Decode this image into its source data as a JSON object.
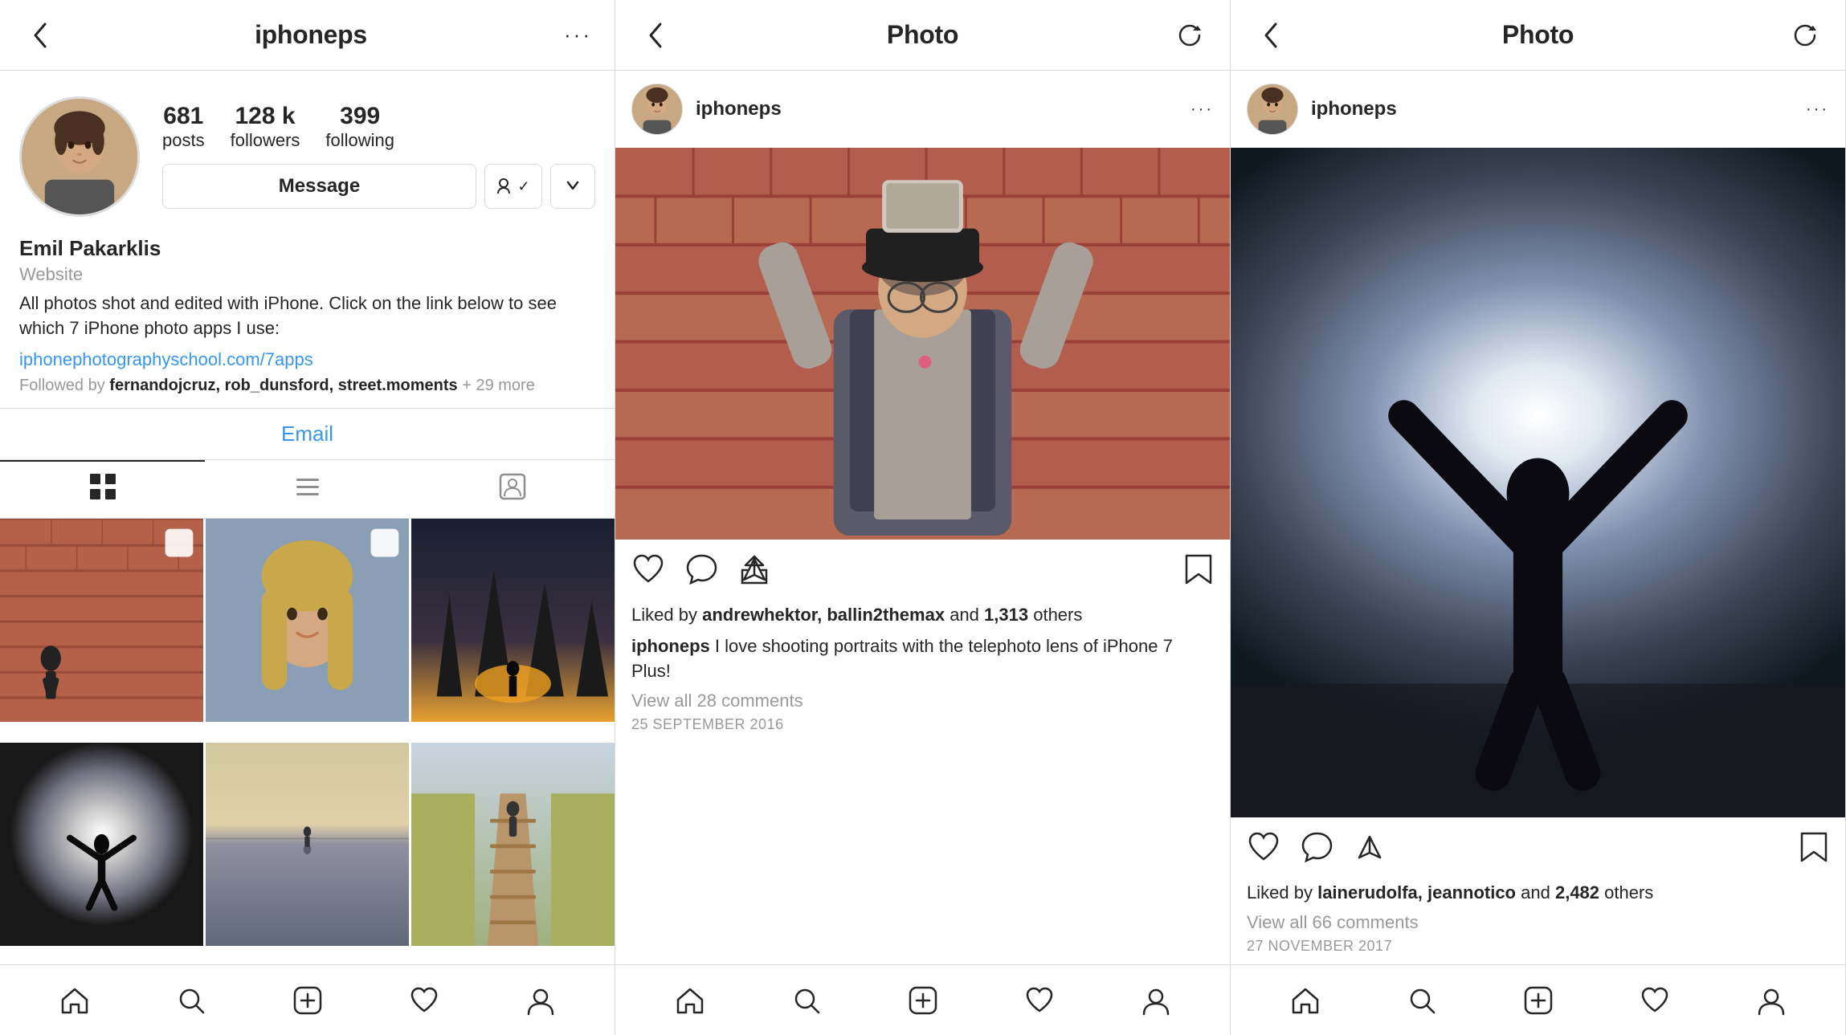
{
  "panels": [
    {
      "id": "profile",
      "nav": {
        "back_icon": "‹",
        "title": "iphoneps",
        "more_icon": "···"
      },
      "profile": {
        "username": "iphoneps",
        "name": "Emil Pakarklis",
        "website_label": "Website",
        "bio": "All photos shot and edited with iPhone. Click on the link below to see which 7 iPhone photo apps I use:",
        "link": "iphonephotographyschool.com/7apps",
        "followed_by": "Followed by",
        "followers_list": "fernandojcruz, rob_dunsford, street.moments",
        "more_count": "+ 29 more",
        "stats": [
          {
            "value": "681",
            "label": "posts"
          },
          {
            "value": "128 k",
            "label": "followers"
          },
          {
            "value": "399",
            "label": "following"
          }
        ],
        "message_btn": "Message",
        "email_label": "Email"
      },
      "tabs": [
        {
          "icon": "⊞",
          "active": true
        },
        {
          "icon": "≡",
          "active": false
        },
        {
          "icon": "👤",
          "active": false
        }
      ],
      "grid_photos": [
        {
          "color": "brick"
        },
        {
          "color": "portrait"
        },
        {
          "color": "forest"
        },
        {
          "color": "silhouette"
        },
        {
          "color": "lake"
        },
        {
          "color": "path"
        }
      ]
    },
    {
      "id": "photo1",
      "nav": {
        "back_icon": "‹",
        "title": "Photo",
        "refresh_icon": "↻"
      },
      "post": {
        "username": "iphoneps",
        "likes_text": "Liked by",
        "likers": "andrewhektor, ballin2themax",
        "and_text": "and",
        "likes_count": "1,313",
        "others": "others",
        "caption_user": "iphoneps",
        "caption_text": "I love shooting portraits with the telephoto lens of iPhone 7 Plus!",
        "view_comments": "View all 28 comments",
        "timestamp": "25 September 2016"
      }
    },
    {
      "id": "photo2",
      "nav": {
        "back_icon": "‹",
        "title": "Photo",
        "refresh_icon": "↻"
      },
      "post": {
        "username": "iphoneps",
        "likes_text": "Liked by",
        "likers": "lainerudolfa, jeannotico",
        "and_text": "and",
        "likes_count": "2,482",
        "others": "others",
        "caption_user": "",
        "caption_text": "",
        "view_comments": "View all 66 comments",
        "timestamp": "27 November 2017"
      }
    }
  ],
  "bottom_nav": {
    "items": [
      {
        "icon": "home",
        "label": "Home"
      },
      {
        "icon": "search",
        "label": "Search"
      },
      {
        "icon": "add",
        "label": "Add"
      },
      {
        "icon": "heart",
        "label": "Likes"
      },
      {
        "icon": "profile",
        "label": "Profile"
      }
    ]
  }
}
